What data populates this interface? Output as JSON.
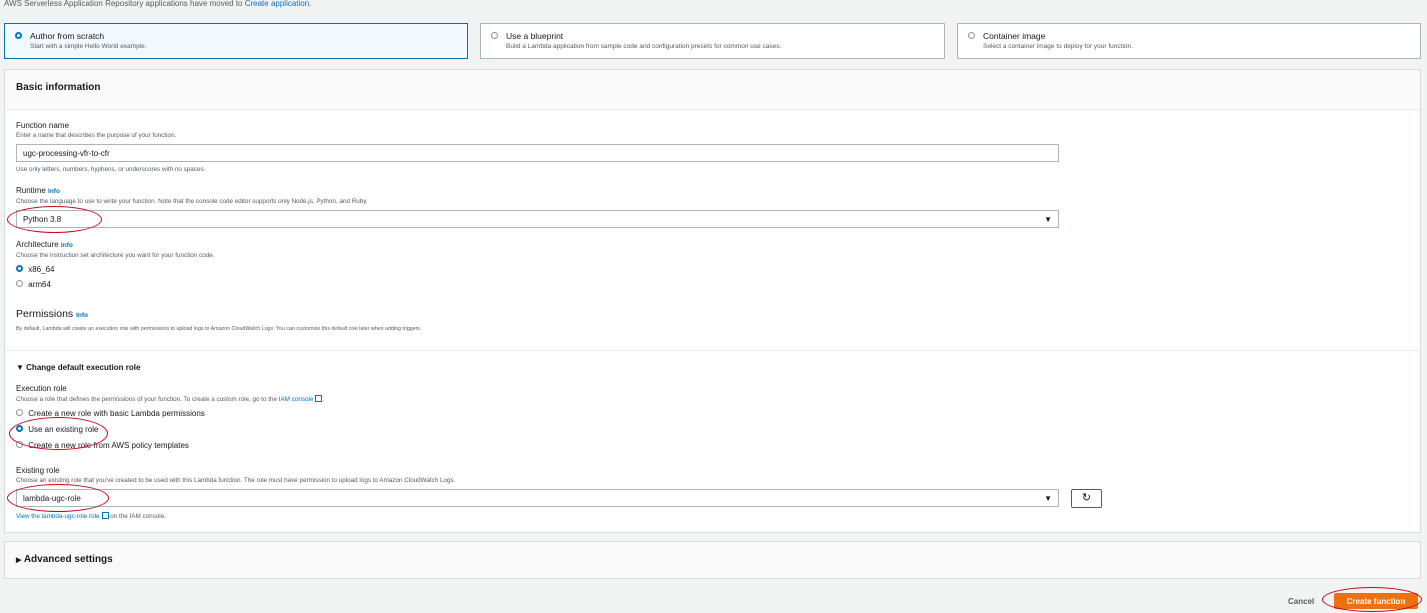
{
  "notice": {
    "text": "AWS Serverless Application Repository applications have moved to ",
    "link": "Create application",
    "end": "."
  },
  "options": [
    {
      "title": "Author from scratch",
      "desc": "Start with a simple Hello World example."
    },
    {
      "title": "Use a blueprint",
      "desc": "Build a Lambda application from sample code and configuration presets for common use cases."
    },
    {
      "title": "Container image",
      "desc": "Select a container image to deploy for your function."
    }
  ],
  "basic": {
    "title": "Basic information",
    "fn_label": "Function name",
    "fn_desc": "Enter a name that describes the purpose of your function.",
    "fn_value": "ugc-processing-vfr-to-cfr",
    "fn_hint": "Use only letters, numbers, hyphens, or underscores with no spaces.",
    "runtime_label": "Runtime",
    "runtime_desc": "Choose the language to use to write your function. Note that the console code editor supports only Node.js, Python, and Ruby.",
    "runtime_value": "Python 3.8",
    "arch_label": "Architecture",
    "arch_desc": "Choose the instruction set architecture you want for your function code.",
    "arch_opt1": "x86_64",
    "arch_opt2": "arm64",
    "info": "Info"
  },
  "permissions": {
    "title": "Permissions",
    "desc": "By default, Lambda will create an execution role with permissions to upload logs to Amazon CloudWatch Logs. You can customize this default role later when adding triggers.",
    "expander": "Change default execution role",
    "exec_label": "Execution role",
    "exec_desc": "Choose a role that defines the permissions of your function. To create a custom role, go to the ",
    "exec_link": "IAM console",
    "exec_end": ".",
    "role_opt1": "Create a new role with basic Lambda permissions",
    "role_opt2": "Use an existing role",
    "role_opt3": "Create a new role from AWS policy templates",
    "existing_label": "Existing role",
    "existing_desc": "Choose an existing role that you've created to be used with this Lambda function. The role must have permission to upload logs to Amazon CloudWatch Logs.",
    "existing_value": "lambda-ugc-role",
    "view_link": "View the lambda-ugc-role role",
    "view_end": " on the IAM console."
  },
  "advanced": {
    "title": "Advanced settings"
  },
  "footer": {
    "cancel": "Cancel",
    "create": "Create function"
  },
  "colors": {
    "accent": "#0073bb",
    "primary_button": "#ec7211",
    "annotation": "#d0021b"
  }
}
